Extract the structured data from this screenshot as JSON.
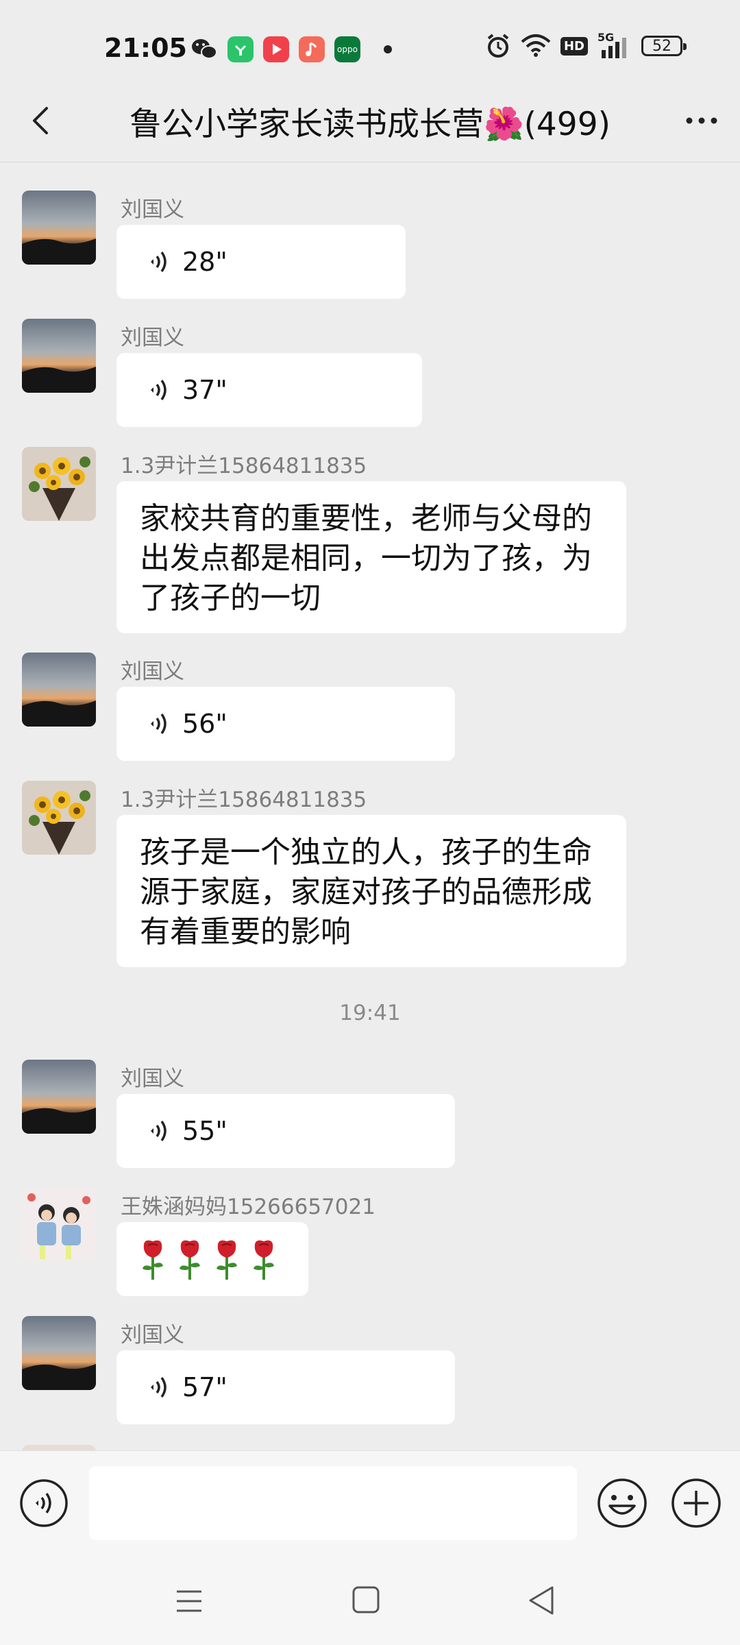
{
  "status_bar": {
    "time": "21:05",
    "app_icons": [
      "wechat-icon",
      "app-store-icon",
      "video-app-icon",
      "music-app-icon",
      "oppo-app-icon"
    ],
    "oppo_label": "oppo",
    "network_hd": "HD",
    "network_type": "5G",
    "battery_level": "52"
  },
  "header": {
    "title": "鲁公小学家长读书成长营🌺(499)"
  },
  "messages": [
    {
      "type": "voice",
      "sender": "刘国义",
      "duration": "28\""
    },
    {
      "type": "voice",
      "sender": "刘国义",
      "duration": "37\""
    },
    {
      "type": "text",
      "sender": "1.3尹计兰15864811835",
      "text": "家校共育的重要性，老师与父母的出发点都是相同，一切为了孩，为了孩子的一切"
    },
    {
      "type": "voice",
      "sender": "刘国义",
      "duration": "56\""
    },
    {
      "type": "text",
      "sender": "1.3尹计兰15864811835",
      "text": "孩子是一个独立的人，孩子的生命源于家庭，家庭对孩子的品德形成有着重要的影响"
    },
    {
      "type": "timestamp",
      "time": "19:41"
    },
    {
      "type": "voice",
      "sender": "刘国义",
      "duration": "55\""
    },
    {
      "type": "emoji",
      "sender": "王姝涵妈妈15266657021",
      "emoji": "🌹🌹🌹🌹",
      "count": 4
    },
    {
      "type": "voice",
      "sender": "刘国义",
      "duration": "57\""
    }
  ],
  "input_bar": {
    "placeholder": ""
  },
  "colors": {
    "background": "#ededed",
    "bubble": "#ffffff",
    "sender_text": "#7d7d7d",
    "input_bar": "#f6f6f6"
  }
}
